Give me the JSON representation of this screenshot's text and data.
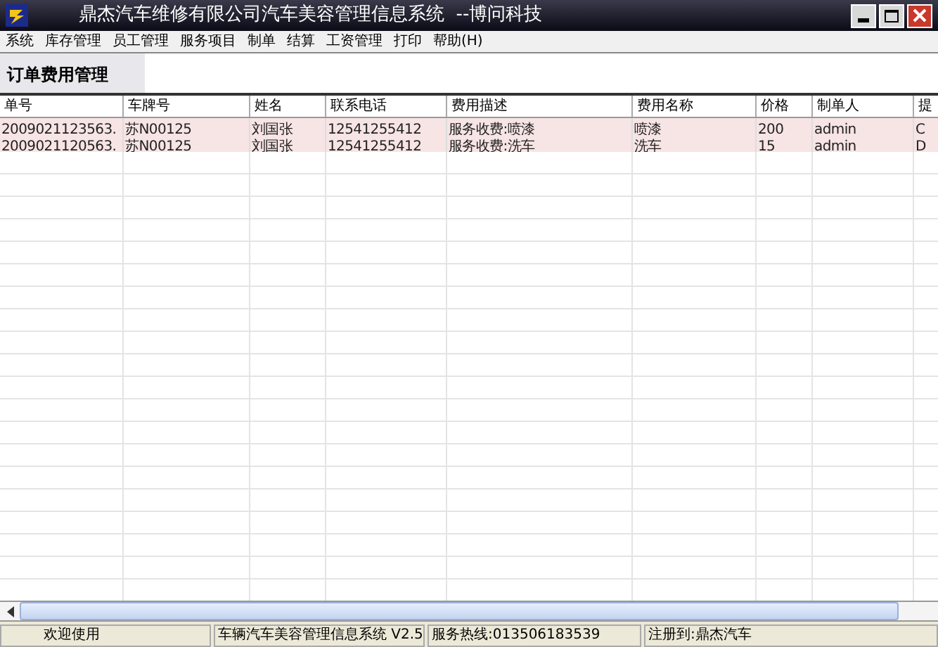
{
  "window": {
    "title": "鼎杰汽车维修有限公司汽车美容管理信息系统  --博问科技"
  },
  "menu": [
    "系统",
    "库存管理",
    "员工管理",
    "服务项目",
    "制单",
    "结算",
    "工资管理",
    "打印",
    "帮助(H)"
  ],
  "panel_title": "订单费用管理",
  "table": {
    "columns": [
      "单号",
      "车牌号",
      "姓名",
      "联系电话",
      "费用描述",
      "费用名称",
      "价格",
      "制单人",
      "提"
    ],
    "rows": [
      {
        "selected": true,
        "cells": [
          "2009021123563.",
          "苏N00125",
          "刘国张",
          "12541255412",
          "服务收费:喷漆",
          "喷漆",
          "200",
          "admin",
          "C"
        ]
      },
      {
        "selected": true,
        "cells": [
          "2009021120563.",
          "苏N00125",
          "刘国张",
          "12541255412",
          "服务收费:洗车",
          "洗车",
          "15",
          "admin",
          "D"
        ]
      }
    ]
  },
  "status_bar": [
    "欢迎使用",
    "车辆汽车美容管理信息系统 V2.5",
    "服务热线:013506183539",
    "注册到:鼎杰汽车"
  ]
}
